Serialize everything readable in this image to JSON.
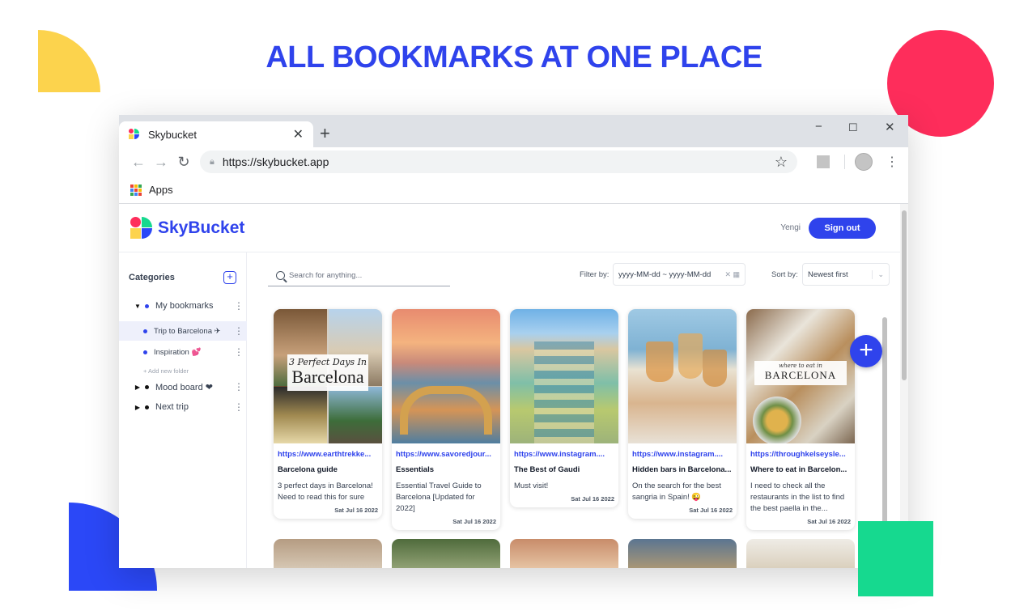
{
  "headline": "ALL BOOKMARKS AT ONE PLACE",
  "browser": {
    "tab_title": "Skybucket",
    "url": "https://skybucket.app",
    "bookmarks_bar": "Apps"
  },
  "app": {
    "brand": "SkyBucket",
    "user": "Yengi",
    "signout_label": "Sign out"
  },
  "sidebar": {
    "title": "Categories",
    "add_new_folder": "+ Add new folder",
    "items": [
      {
        "label": "My bookmarks",
        "expanded": true
      },
      {
        "label": "Trip to Barcelona ✈",
        "sub": true,
        "active": true
      },
      {
        "label": "Inspiration 💕",
        "sub": true
      },
      {
        "label": "Mood board ❤",
        "expanded": false
      },
      {
        "label": "Next trip",
        "expanded": false
      }
    ]
  },
  "toolbar": {
    "search_placeholder": "Search for anything...",
    "filter_label": "Filter by:",
    "date_range_placeholder": "yyyy-MM-dd ~ yyyy-MM-dd",
    "sort_label": "Sort by:",
    "sort_value": "Newest first"
  },
  "cards": [
    {
      "url": "https://www.earthtrekke...",
      "title": "Barcelona guide",
      "description": "3 perfect days in Barcelona! Need to read this for sure",
      "date": "Sat Jul 16 2022",
      "image_overlay": [
        "3 Perfect Days In",
        "Barcelona"
      ]
    },
    {
      "url": "https://www.savoredjour...",
      "title": "Essentials",
      "description": "Essential Travel Guide to Barcelona [Updated for 2022]",
      "date": "Sat Jul 16 2022"
    },
    {
      "url": "https://www.instagram....",
      "title": "The Best of Gaudi",
      "description": "Must visit!",
      "date": "Sat Jul 16 2022"
    },
    {
      "url": "https://www.instagram....",
      "title": "Hidden bars in Barcelona...",
      "description": "On the search for the best sangria in Spain! 😜",
      "date": "Sat Jul 16 2022"
    },
    {
      "url": "https://throughkelseysle...",
      "title": "Where to eat in Barcelon...",
      "description": "I need to check all the restaurants in the list to find the best paella in the...",
      "date": "Sat Jul 16 2022",
      "image_overlay": [
        "where to eat in",
        "BARCELONA"
      ]
    }
  ],
  "colors": {
    "brand": "#2f43ec",
    "yellow": "#fcd34d",
    "red": "#fe2d5b",
    "blue": "#2b48f7",
    "green": "#16d98f"
  }
}
